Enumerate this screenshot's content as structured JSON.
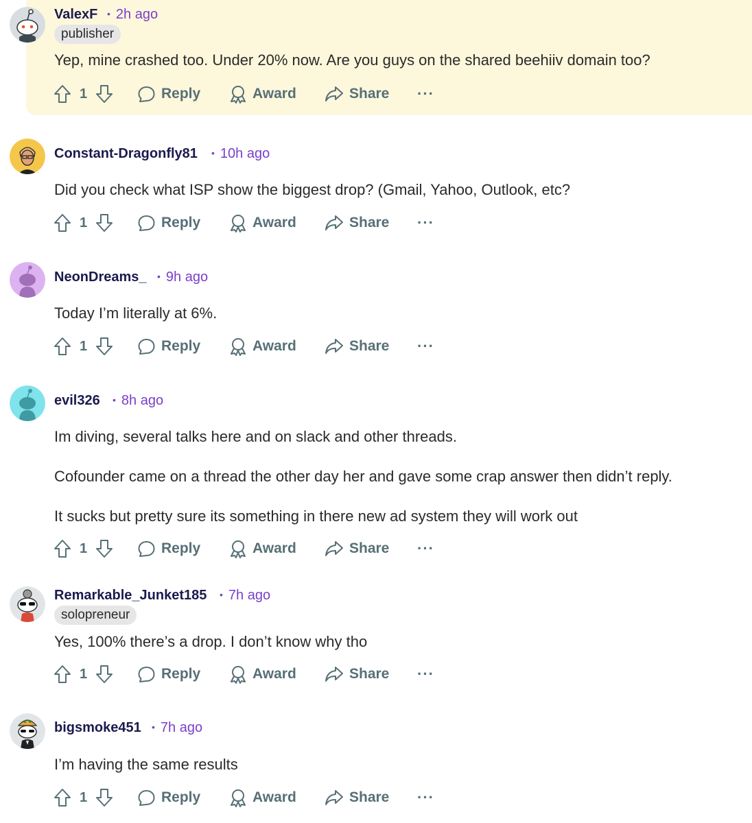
{
  "actions": {
    "reply": "Reply",
    "award": "Award",
    "share": "Share",
    "more": "···"
  },
  "colors": {
    "author": "#1a1a4e",
    "time": "#7a3fc9",
    "highlight_bg": "#fdf7dc",
    "action": "#576f76"
  },
  "comments": [
    {
      "author": "ValexF",
      "time": "2h ago",
      "flair": "publisher",
      "votes": "1",
      "highlighted": true,
      "avatar": "snoo-default-icon",
      "lines": [
        "Yep, mine crashed too. Under 20% now. Are you guys on the shared beehiiv domain too?"
      ]
    },
    {
      "author": "Constant-Dragonfly81",
      "time": "10h ago",
      "votes": "1",
      "avatar": "yellow-person-icon",
      "lines": [
        "Did you check what ISP show the biggest drop? (Gmail, Yahoo, Outlook, etc?"
      ]
    },
    {
      "author": "NeonDreams_",
      "time": "9h ago",
      "votes": "1",
      "avatar": "purple-snoo-icon",
      "lines": [
        "Today I’m literally at 6%."
      ]
    },
    {
      "author": "evil326",
      "time": "8h ago",
      "votes": "1",
      "avatar": "teal-snoo-icon",
      "lines": [
        "Im diving, several talks here and on slack and other threads.",
        "Cofounder came on a thread the other day her and gave some crap answer then didn’t reply.",
        "It sucks but pretty sure its something in there new ad system they will work out"
      ]
    },
    {
      "author": "Remarkable_Junket185",
      "time": "7h ago",
      "flair": "solopreneur",
      "votes": "1",
      "avatar": "snoo-sunglasses-icon",
      "lines": [
        "Yes, 100% there’s a drop. I don’t know why tho"
      ]
    },
    {
      "author": "bigsmoke451",
      "time": "7h ago",
      "votes": "1",
      "avatar": "snoo-tiger-hat-icon",
      "lines": [
        "I’m having the same results"
      ]
    }
  ]
}
